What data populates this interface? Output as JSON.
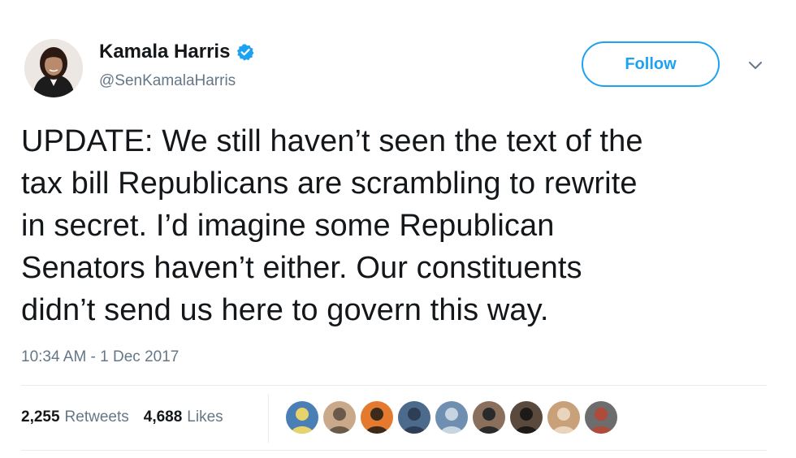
{
  "header": {
    "display_name": "Kamala Harris",
    "handle": "@SenKamalaHarris",
    "verified": true,
    "follow_label": "Follow",
    "menu_icon": "chevron-down-icon",
    "accent_color": "#1da1f2"
  },
  "tweet": {
    "text_lines": [
      "UPDATE: We still haven’t seen the text of the",
      "tax bill Republicans are scrambling to rewrite",
      "in secret. I’d imagine some Republican",
      "Senators haven’t either. Our constituents",
      "didn’t send us here to govern this way."
    ],
    "timestamp": "10:34 AM - 1 Dec 2017"
  },
  "stats": {
    "retweets_count": "2,255",
    "retweets_label": "Retweets",
    "likes_count": "4,688",
    "likes_label": "Likes"
  },
  "liked_by": {
    "avatar_colors": [
      [
        "#4a7fb5",
        "#e8d36a"
      ],
      [
        "#c9a98a",
        "#6b5a4a"
      ],
      [
        "#e37a2e",
        "#3b2a1a"
      ],
      [
        "#4b6a8c",
        "#2e3f55"
      ],
      [
        "#6f8fb0",
        "#c7d5e2"
      ],
      [
        "#8a6f5d",
        "#2a2a2a"
      ],
      [
        "#5a4a3d",
        "#1e1a17"
      ],
      [
        "#c8a07a",
        "#e9d4be"
      ],
      [
        "#6d6d6d",
        "#b04a3a"
      ]
    ]
  }
}
